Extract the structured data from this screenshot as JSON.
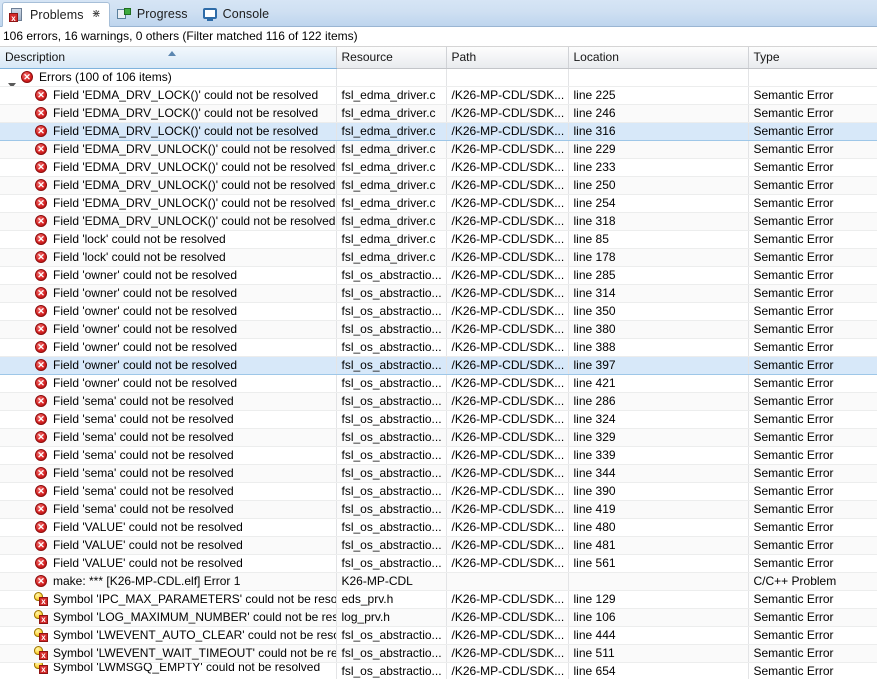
{
  "tabs": [
    {
      "label": "Problems",
      "icon": "problems-icon",
      "active": true,
      "close_glyph": "⋇"
    },
    {
      "label": "Progress",
      "icon": "progress-icon",
      "active": false
    },
    {
      "label": "Console",
      "icon": "console-icon",
      "active": false
    }
  ],
  "status": {
    "text": "106 errors, 16 warnings, 0 others (Filter matched 116 of 122 items)",
    "errors": 106,
    "warnings": 16,
    "others": 0,
    "filter_matched": 116,
    "total_items": 122
  },
  "columns": [
    {
      "label": "Description",
      "sorted": true,
      "sort_direction": "asc"
    },
    {
      "label": "Resource",
      "sorted": false
    },
    {
      "label": "Path",
      "sorted": false
    },
    {
      "label": "Location",
      "sorted": false
    },
    {
      "label": "Type",
      "sorted": false
    }
  ],
  "group": {
    "label": "Errors (100 of 106 items)",
    "expanded": true,
    "marker": "error-icon",
    "resource": "",
    "path": "",
    "location": "",
    "type": ""
  },
  "rows": [
    {
      "marker": "error-icon",
      "description": "Field 'EDMA_DRV_LOCK()' could not be resolved",
      "resource": "fsl_edma_driver.c",
      "path": "/K26-MP-CDL/SDK...",
      "location": "line 225",
      "type": "Semantic Error",
      "selected": false
    },
    {
      "marker": "error-icon",
      "description": "Field 'EDMA_DRV_LOCK()' could not be resolved",
      "resource": "fsl_edma_driver.c",
      "path": "/K26-MP-CDL/SDK...",
      "location": "line 246",
      "type": "Semantic Error",
      "selected": false
    },
    {
      "marker": "error-icon",
      "description": "Field 'EDMA_DRV_LOCK()' could not be resolved",
      "resource": "fsl_edma_driver.c",
      "path": "/K26-MP-CDL/SDK...",
      "location": "line 316",
      "type": "Semantic Error",
      "selected": true
    },
    {
      "marker": "error-icon",
      "description": "Field 'EDMA_DRV_UNLOCK()' could not be resolved",
      "resource": "fsl_edma_driver.c",
      "path": "/K26-MP-CDL/SDK...",
      "location": "line 229",
      "type": "Semantic Error",
      "selected": false
    },
    {
      "marker": "error-icon",
      "description": "Field 'EDMA_DRV_UNLOCK()' could not be resolved",
      "resource": "fsl_edma_driver.c",
      "path": "/K26-MP-CDL/SDK...",
      "location": "line 233",
      "type": "Semantic Error",
      "selected": false
    },
    {
      "marker": "error-icon",
      "description": "Field 'EDMA_DRV_UNLOCK()' could not be resolved",
      "resource": "fsl_edma_driver.c",
      "path": "/K26-MP-CDL/SDK...",
      "location": "line 250",
      "type": "Semantic Error",
      "selected": false
    },
    {
      "marker": "error-icon",
      "description": "Field 'EDMA_DRV_UNLOCK()' could not be resolved",
      "resource": "fsl_edma_driver.c",
      "path": "/K26-MP-CDL/SDK...",
      "location": "line 254",
      "type": "Semantic Error",
      "selected": false
    },
    {
      "marker": "error-icon",
      "description": "Field 'EDMA_DRV_UNLOCK()' could not be resolved",
      "resource": "fsl_edma_driver.c",
      "path": "/K26-MP-CDL/SDK...",
      "location": "line 318",
      "type": "Semantic Error",
      "selected": false
    },
    {
      "marker": "error-icon",
      "description": "Field 'lock' could not be resolved",
      "resource": "fsl_edma_driver.c",
      "path": "/K26-MP-CDL/SDK...",
      "location": "line 85",
      "type": "Semantic Error",
      "selected": false
    },
    {
      "marker": "error-icon",
      "description": "Field 'lock' could not be resolved",
      "resource": "fsl_edma_driver.c",
      "path": "/K26-MP-CDL/SDK...",
      "location": "line 178",
      "type": "Semantic Error",
      "selected": false
    },
    {
      "marker": "error-icon",
      "description": "Field 'owner' could not be resolved",
      "resource": "fsl_os_abstractio...",
      "path": "/K26-MP-CDL/SDK...",
      "location": "line 285",
      "type": "Semantic Error",
      "selected": false
    },
    {
      "marker": "error-icon",
      "description": "Field 'owner' could not be resolved",
      "resource": "fsl_os_abstractio...",
      "path": "/K26-MP-CDL/SDK...",
      "location": "line 314",
      "type": "Semantic Error",
      "selected": false
    },
    {
      "marker": "error-icon",
      "description": "Field 'owner' could not be resolved",
      "resource": "fsl_os_abstractio...",
      "path": "/K26-MP-CDL/SDK...",
      "location": "line 350",
      "type": "Semantic Error",
      "selected": false
    },
    {
      "marker": "error-icon",
      "description": "Field 'owner' could not be resolved",
      "resource": "fsl_os_abstractio...",
      "path": "/K26-MP-CDL/SDK...",
      "location": "line 380",
      "type": "Semantic Error",
      "selected": false
    },
    {
      "marker": "error-icon",
      "description": "Field 'owner' could not be resolved",
      "resource": "fsl_os_abstractio...",
      "path": "/K26-MP-CDL/SDK...",
      "location": "line 388",
      "type": "Semantic Error",
      "selected": false
    },
    {
      "marker": "error-icon",
      "description": "Field 'owner' could not be resolved",
      "resource": "fsl_os_abstractio...",
      "path": "/K26-MP-CDL/SDK...",
      "location": "line 397",
      "type": "Semantic Error",
      "selected": true
    },
    {
      "marker": "error-icon",
      "description": "Field 'owner' could not be resolved",
      "resource": "fsl_os_abstractio...",
      "path": "/K26-MP-CDL/SDK...",
      "location": "line 421",
      "type": "Semantic Error",
      "selected": false
    },
    {
      "marker": "error-icon",
      "description": "Field 'sema' could not be resolved",
      "resource": "fsl_os_abstractio...",
      "path": "/K26-MP-CDL/SDK...",
      "location": "line 286",
      "type": "Semantic Error",
      "selected": false
    },
    {
      "marker": "error-icon",
      "description": "Field 'sema' could not be resolved",
      "resource": "fsl_os_abstractio...",
      "path": "/K26-MP-CDL/SDK...",
      "location": "line 324",
      "type": "Semantic Error",
      "selected": false
    },
    {
      "marker": "error-icon",
      "description": "Field 'sema' could not be resolved",
      "resource": "fsl_os_abstractio...",
      "path": "/K26-MP-CDL/SDK...",
      "location": "line 329",
      "type": "Semantic Error",
      "selected": false
    },
    {
      "marker": "error-icon",
      "description": "Field 'sema' could not be resolved",
      "resource": "fsl_os_abstractio...",
      "path": "/K26-MP-CDL/SDK...",
      "location": "line 339",
      "type": "Semantic Error",
      "selected": false
    },
    {
      "marker": "error-icon",
      "description": "Field 'sema' could not be resolved",
      "resource": "fsl_os_abstractio...",
      "path": "/K26-MP-CDL/SDK...",
      "location": "line 344",
      "type": "Semantic Error",
      "selected": false
    },
    {
      "marker": "error-icon",
      "description": "Field 'sema' could not be resolved",
      "resource": "fsl_os_abstractio...",
      "path": "/K26-MP-CDL/SDK...",
      "location": "line 390",
      "type": "Semantic Error",
      "selected": false
    },
    {
      "marker": "error-icon",
      "description": "Field 'sema' could not be resolved",
      "resource": "fsl_os_abstractio...",
      "path": "/K26-MP-CDL/SDK...",
      "location": "line 419",
      "type": "Semantic Error",
      "selected": false
    },
    {
      "marker": "error-icon",
      "description": "Field 'VALUE' could not be resolved",
      "resource": "fsl_os_abstractio...",
      "path": "/K26-MP-CDL/SDK...",
      "location": "line 480",
      "type": "Semantic Error",
      "selected": false
    },
    {
      "marker": "error-icon",
      "description": "Field 'VALUE' could not be resolved",
      "resource": "fsl_os_abstractio...",
      "path": "/K26-MP-CDL/SDK...",
      "location": "line 481",
      "type": "Semantic Error",
      "selected": false
    },
    {
      "marker": "error-icon",
      "description": "Field 'VALUE' could not be resolved",
      "resource": "fsl_os_abstractio...",
      "path": "/K26-MP-CDL/SDK...",
      "location": "line 561",
      "type": "Semantic Error",
      "selected": false
    },
    {
      "marker": "error-icon",
      "description": "make: *** [K26-MP-CDL.elf] Error 1",
      "resource": "K26-MP-CDL",
      "path": "",
      "location": "",
      "type": "C/C++ Problem",
      "selected": false
    },
    {
      "marker": "quickfix-error-icon",
      "description": "Symbol 'IPC_MAX_PARAMETERS' could not be resolved",
      "resource": "eds_prv.h",
      "path": "/K26-MP-CDL/SDK...",
      "location": "line 129",
      "type": "Semantic Error",
      "selected": false
    },
    {
      "marker": "quickfix-error-icon",
      "description": "Symbol 'LOG_MAXIMUM_NUMBER' could not be resolved",
      "resource": "log_prv.h",
      "path": "/K26-MP-CDL/SDK...",
      "location": "line 106",
      "type": "Semantic Error",
      "selected": false
    },
    {
      "marker": "quickfix-error-icon",
      "description": "Symbol 'LWEVENT_AUTO_CLEAR' could not be resolved",
      "resource": "fsl_os_abstractio...",
      "path": "/K26-MP-CDL/SDK...",
      "location": "line 444",
      "type": "Semantic Error",
      "selected": false
    },
    {
      "marker": "quickfix-error-icon",
      "description": "Symbol 'LWEVENT_WAIT_TIMEOUT' could not be resolved",
      "resource": "fsl_os_abstractio...",
      "path": "/K26-MP-CDL/SDK...",
      "location": "line 511",
      "type": "Semantic Error",
      "selected": false
    },
    {
      "marker": "quickfix-error-icon",
      "description": "Symbol 'LWMSGQ_EMPTY' could not be resolved",
      "resource": "fsl_os_abstractio...",
      "path": "/K26-MP-CDL/SDK...",
      "location": "line 654",
      "type": "Semantic Error",
      "selected": false
    }
  ]
}
